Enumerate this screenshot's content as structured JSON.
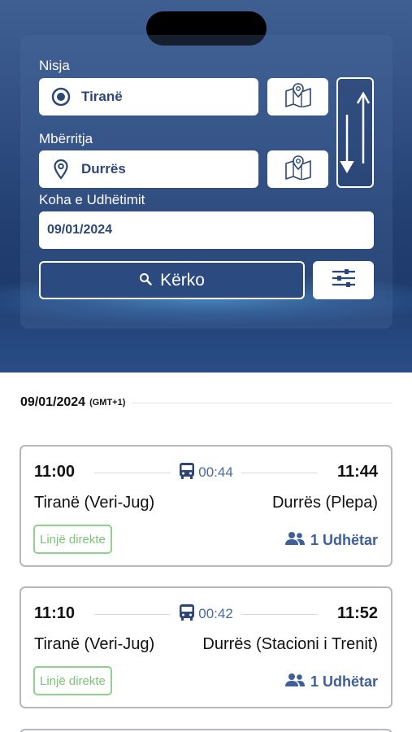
{
  "search": {
    "from_label": "Nisja",
    "from_value": "Tiranë",
    "to_label": "Mbërritja",
    "to_value": "Durrës",
    "time_label": "Koha e Udhëtimit",
    "date_value": "09/01/2024",
    "search_button": "Kërko"
  },
  "results": {
    "date": "09/01/2024",
    "timezone": "(GMT+1)",
    "trips": [
      {
        "depart_time": "11:00",
        "duration": "00:44",
        "arrive_time": "11:44",
        "from_station": "Tiranë (Veri-Jug)",
        "to_station": "Durrës (Plepa)",
        "badge": "Linjë direkte",
        "passengers": "1 Udhëtar"
      },
      {
        "depart_time": "11:10",
        "duration": "00:42",
        "arrive_time": "11:52",
        "from_station": "Tiranë (Veri-Jug)",
        "to_station": "Durrës (Stacioni i Trenit)",
        "badge": "Linjë direkte",
        "passengers": "1 Udhëtar"
      }
    ]
  },
  "colors": {
    "primary": "#2e4677",
    "header": "#2b4a80",
    "badge_green": "#7cc277",
    "accent_blue": "#3f5f97"
  },
  "icons": {
    "origin": "radio-dot-icon",
    "destination": "location-pin-icon",
    "map": "map-icon",
    "swap": "swap-arrows-icon",
    "search": "search-icon",
    "filter": "sliders-icon",
    "bus": "bus-icon",
    "passengers": "people-icon"
  }
}
